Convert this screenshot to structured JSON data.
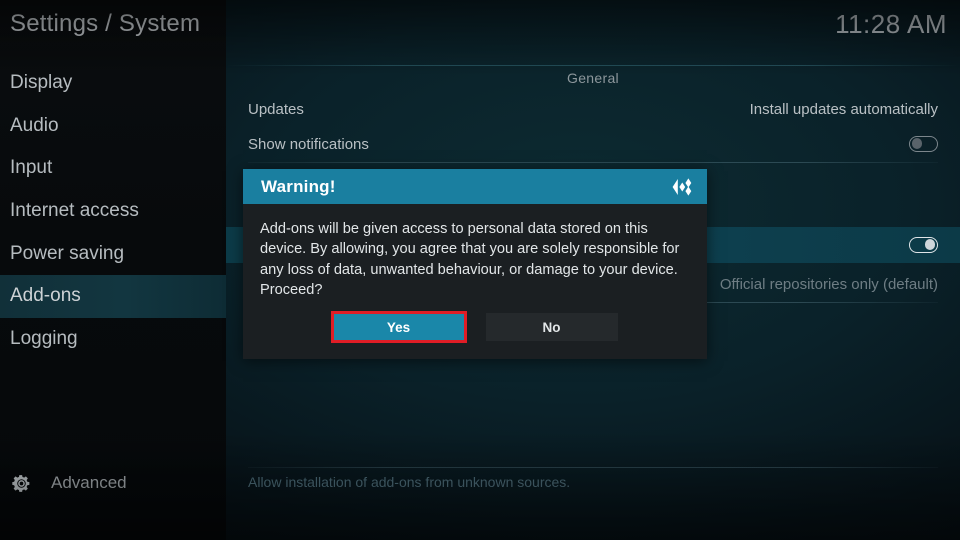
{
  "header": {
    "title": "Settings / System",
    "clock": "11:28 AM"
  },
  "sidebar": {
    "items": [
      {
        "label": "Display",
        "selected": false
      },
      {
        "label": "Audio",
        "selected": false
      },
      {
        "label": "Input",
        "selected": false
      },
      {
        "label": "Internet access",
        "selected": false
      },
      {
        "label": "Power saving",
        "selected": false
      },
      {
        "label": "Add-ons",
        "selected": true
      },
      {
        "label": "Logging",
        "selected": false
      }
    ],
    "advanced": {
      "label": "Advanced",
      "icon": "gear-icon"
    }
  },
  "content": {
    "group_title": "General",
    "rows": [
      {
        "label": "Updates",
        "value": "Install updates automatically",
        "control": "text",
        "highlighted": false
      },
      {
        "label": "Show notifications",
        "value": "",
        "control": "toggle",
        "toggle_state": "off",
        "highlighted": false
      },
      {
        "label": "",
        "value": "",
        "control": "toggle",
        "toggle_state": "on",
        "highlighted": true
      },
      {
        "label": "",
        "value": "Official repositories only (default)",
        "control": "text",
        "highlighted": false
      }
    ],
    "description": "Allow installation of add-ons from unknown sources."
  },
  "dialog": {
    "title": "Warning!",
    "icon": "kodi-logo-icon",
    "message": "Add-ons will be given access to personal data stored on this device. By allowing, you agree that you are solely responsible for any loss of data, unwanted behaviour, or damage to your device. Proceed?",
    "buttons": {
      "yes": "Yes",
      "no": "No"
    },
    "focused_button": "Yes"
  },
  "colors": {
    "accent_teal": "#1a87a9",
    "header_teal": "#1a7fa0",
    "focus_red": "#e01d26",
    "row_highlight": "#0e4252",
    "dialog_bg": "#1b1f22"
  }
}
